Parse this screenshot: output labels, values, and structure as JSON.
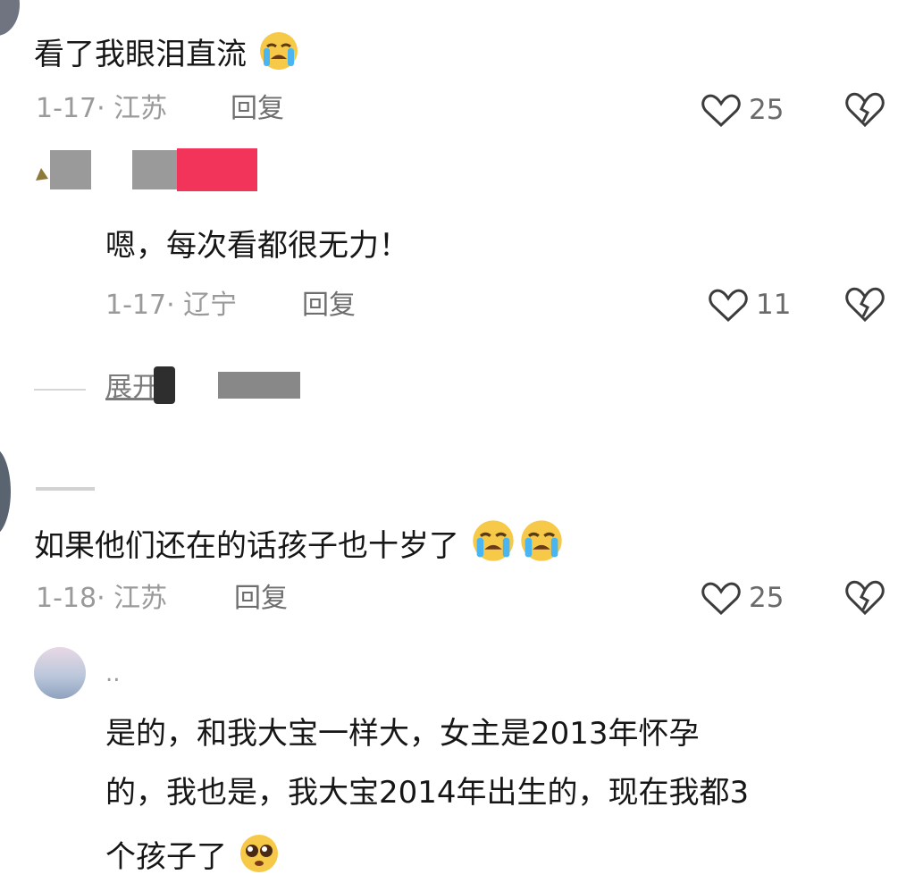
{
  "comments": [
    {
      "text": "看了我眼泪直流",
      "emojis": [
        "loudly-crying-face"
      ],
      "date": "1-17·",
      "location": "江苏",
      "reply_label": "回复",
      "likes": "25"
    },
    {
      "text": "嗯，每次看都很无力！",
      "emojis": [],
      "date": "1-17·",
      "location": "辽宁",
      "reply_label": "回复",
      "likes": "11"
    },
    {
      "text": "如果他们还在的话孩子也十岁了",
      "emojis": [
        "loudly-crying-face",
        "loudly-crying-face"
      ],
      "date": "1-18·",
      "location": "江苏",
      "reply_label": "回复",
      "likes": "25"
    },
    {
      "username": "..",
      "text_lines": [
        "是的，和我大宝一样大，女主是2013年怀孕",
        "的，我也是，我大宝2014年出生的，现在我都3",
        "个孩子了"
      ],
      "emojis": [
        "pleading-face"
      ]
    }
  ],
  "expand_label": "展开",
  "colors": {
    "redaction": "#f2345a",
    "blur_gray": "#9a9a9a"
  }
}
